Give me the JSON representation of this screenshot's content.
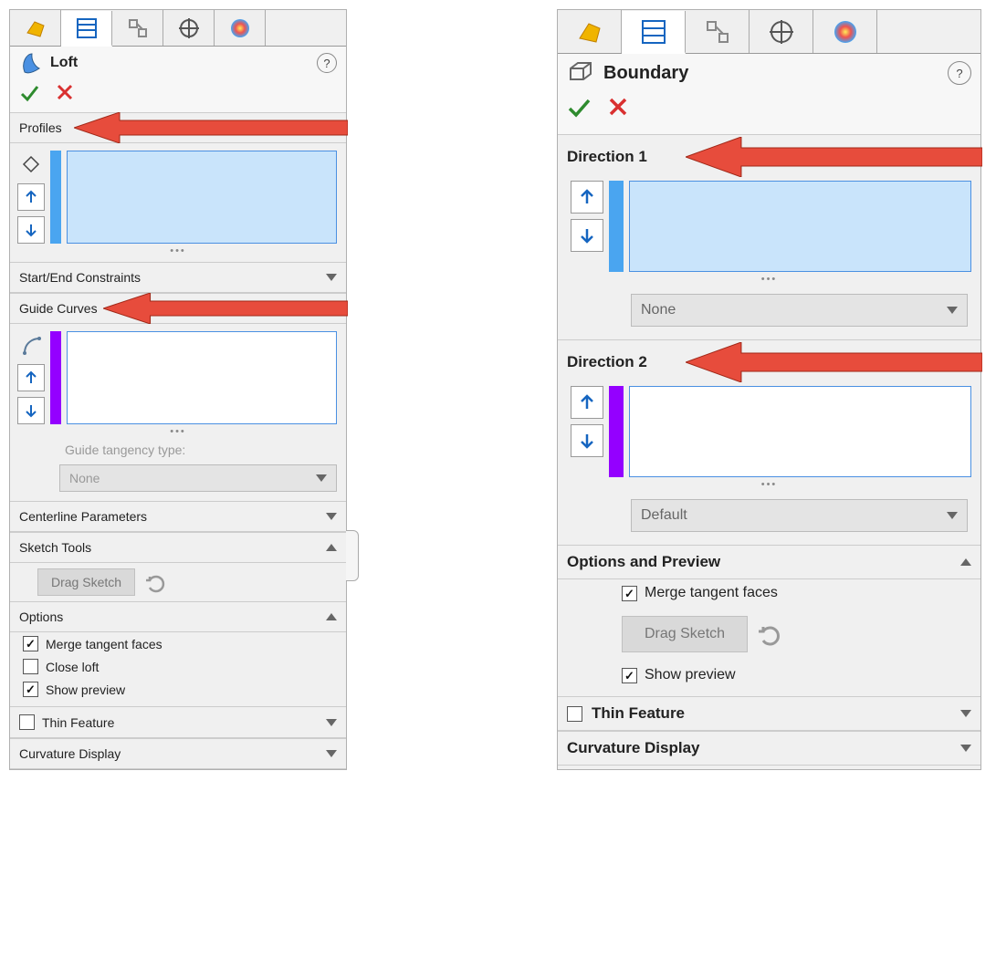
{
  "loft": {
    "title": "Loft",
    "sections": {
      "profiles": "Profiles",
      "startend": "Start/End Constraints",
      "guides": "Guide Curves",
      "centerline": "Centerline Parameters",
      "sketchtools": "Sketch Tools",
      "options": "Options",
      "thin": "Thin Feature",
      "curvature": "Curvature Display"
    },
    "guide_tangency_label": "Guide tangency type:",
    "guide_tangency_value": "None",
    "drag_sketch": "Drag Sketch",
    "options_items": {
      "merge": "Merge tangent faces",
      "close": "Close loft",
      "preview": "Show preview"
    },
    "checks": {
      "merge": true,
      "close": false,
      "preview": true,
      "thin": false
    }
  },
  "boundary": {
    "title": "Boundary",
    "sections": {
      "dir1": "Direction 1",
      "dir2": "Direction 2",
      "optprev": "Options and Preview",
      "thin": "Thin Feature",
      "curvature": "Curvature Display"
    },
    "dir1_combo": "None",
    "dir2_combo": "Default",
    "drag_sketch": "Drag Sketch",
    "options_items": {
      "merge": "Merge tangent faces",
      "preview": "Show preview"
    },
    "checks": {
      "merge": true,
      "preview": true,
      "thin": false
    }
  }
}
